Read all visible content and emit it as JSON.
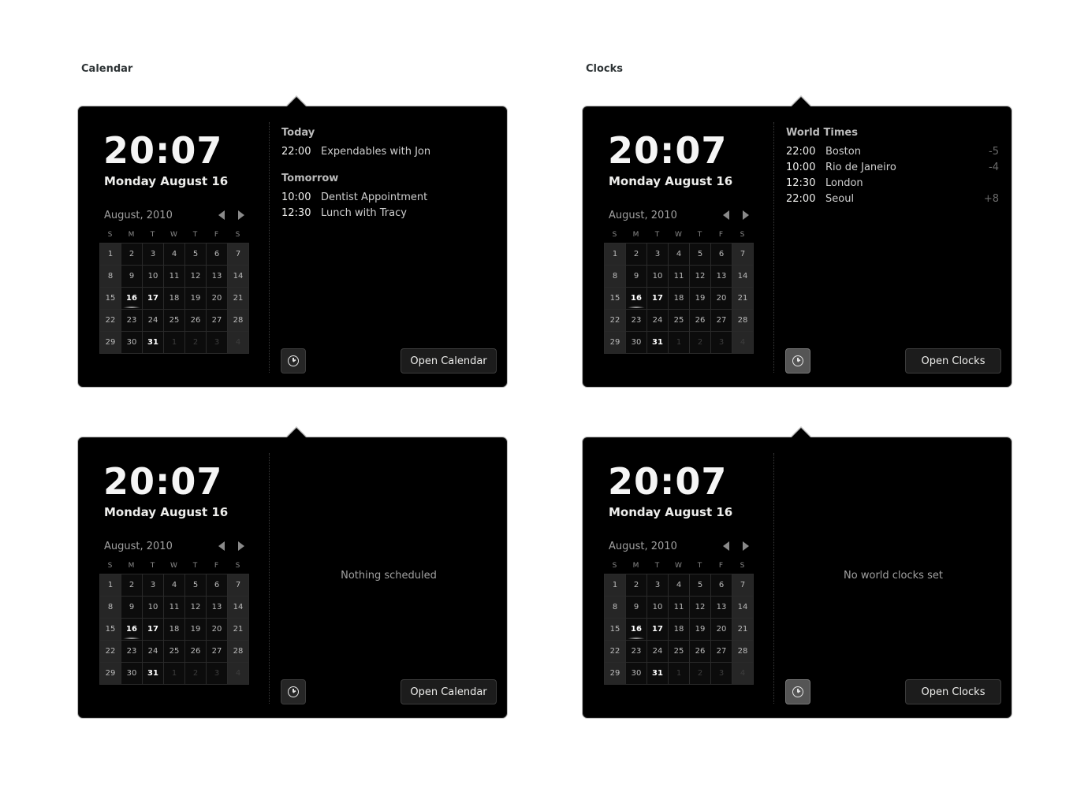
{
  "labels": {
    "calendar": "Calendar",
    "clocks": "Clocks"
  },
  "common": {
    "time": "20:07",
    "date": "Monday August 16",
    "month": "August, 2010",
    "weekdays": [
      "S",
      "M",
      "T",
      "W",
      "T",
      "F",
      "S"
    ],
    "days": [
      {
        "n": "1",
        "k": "weekend"
      },
      {
        "n": "2"
      },
      {
        "n": "3"
      },
      {
        "n": "4"
      },
      {
        "n": "5"
      },
      {
        "n": "6"
      },
      {
        "n": "7",
        "k": "weekend"
      },
      {
        "n": "8",
        "k": "weekend"
      },
      {
        "n": "9"
      },
      {
        "n": "10"
      },
      {
        "n": "11"
      },
      {
        "n": "12"
      },
      {
        "n": "13"
      },
      {
        "n": "14",
        "k": "weekend"
      },
      {
        "n": "15",
        "k": "weekend"
      },
      {
        "n": "16",
        "k": "today"
      },
      {
        "n": "17",
        "k": "bold"
      },
      {
        "n": "18"
      },
      {
        "n": "19"
      },
      {
        "n": "20"
      },
      {
        "n": "21",
        "k": "weekend"
      },
      {
        "n": "22",
        "k": "weekend"
      },
      {
        "n": "23"
      },
      {
        "n": "24"
      },
      {
        "n": "25"
      },
      {
        "n": "26"
      },
      {
        "n": "27"
      },
      {
        "n": "28",
        "k": "weekend"
      },
      {
        "n": "29",
        "k": "weekend"
      },
      {
        "n": "30"
      },
      {
        "n": "31",
        "k": "bold"
      },
      {
        "n": "1",
        "k": "other"
      },
      {
        "n": "2",
        "k": "other"
      },
      {
        "n": "3",
        "k": "other"
      },
      {
        "n": "4",
        "k": "other-weekend"
      }
    ]
  },
  "panels": [
    {
      "id": "calendar-events",
      "sections": [
        {
          "heading": "Today",
          "rows": [
            {
              "time": "22:00",
              "text": "Expendables with Jon"
            }
          ]
        },
        {
          "heading": "Tomorrow",
          "rows": [
            {
              "time": "10:00",
              "text": "Dentist Appointment"
            },
            {
              "time": "12:30",
              "text": "Lunch with Tracy"
            }
          ]
        }
      ],
      "clock_active": false,
      "button": "Open Calendar"
    },
    {
      "id": "clocks-world",
      "sections": [
        {
          "heading": "World Times",
          "rows": [
            {
              "time": "22:00",
              "text": "Boston",
              "offset": "-5"
            },
            {
              "time": "10:00",
              "text": "Rio de Janeiro",
              "offset": "-4"
            },
            {
              "time": "12:30",
              "text": "London",
              "offset": ""
            },
            {
              "time": "22:00",
              "text": "Seoul",
              "offset": "+8"
            }
          ]
        }
      ],
      "clock_active": true,
      "button": "Open Clocks"
    },
    {
      "id": "calendar-empty",
      "empty": "Nothing scheduled",
      "clock_active": false,
      "button": "Open Calendar"
    },
    {
      "id": "clocks-empty",
      "empty": "No world clocks set",
      "clock_active": true,
      "button": "Open Clocks"
    }
  ]
}
